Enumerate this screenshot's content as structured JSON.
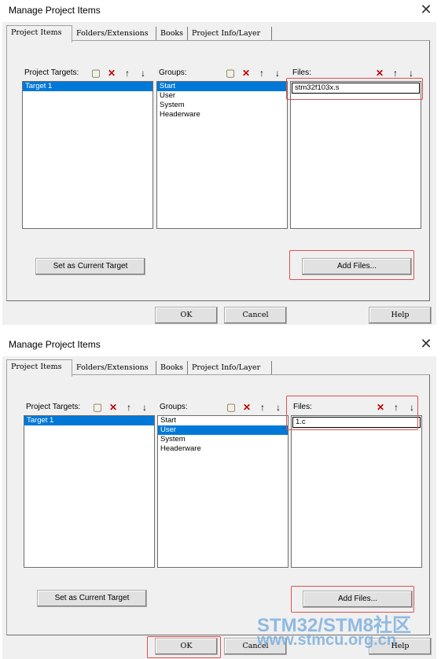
{
  "dialogs": [
    {
      "title": "Manage Project Items",
      "tabs": [
        "Project Items",
        "Folders/Extensions",
        "Books",
        "Project Info/Layer"
      ],
      "targets": {
        "label": "Project Targets:",
        "items": [
          "Target 1"
        ],
        "selected": 0
      },
      "groups": {
        "label": "Groups:",
        "items": [
          "Start",
          "User",
          "System",
          "Headerware"
        ],
        "selected": 0
      },
      "files": {
        "label": "Files:",
        "items": [
          "stm32f103x.s"
        ]
      },
      "set_current_target": "Set as Current Target",
      "add_files": "Add Files...",
      "ok": "OK",
      "cancel": "Cancel",
      "help": "Help"
    },
    {
      "title": "Manage Project Items",
      "tabs": [
        "Project Items",
        "Folders/Extensions",
        "Books",
        "Project Info/Layer"
      ],
      "targets": {
        "label": "Project Targets:",
        "items": [
          "Target 1"
        ],
        "selected": 0
      },
      "groups": {
        "label": "Groups:",
        "items": [
          "Start",
          "User",
          "System",
          "Headerware"
        ],
        "selected": 1
      },
      "files": {
        "label": "Files:",
        "items": [
          "1.c"
        ]
      },
      "set_current_target": "Set as Current Target",
      "add_files": "Add Files...",
      "ok": "OK",
      "cancel": "Cancel",
      "help": "Help"
    }
  ],
  "watermark": {
    "line1": "STM32/STM8社区",
    "line2": "www.stmcu.org.cn"
  },
  "colors": {
    "selection": "#0078d7",
    "highlight_box": "#e05050",
    "dialog_bg": "#f0f0f0"
  }
}
